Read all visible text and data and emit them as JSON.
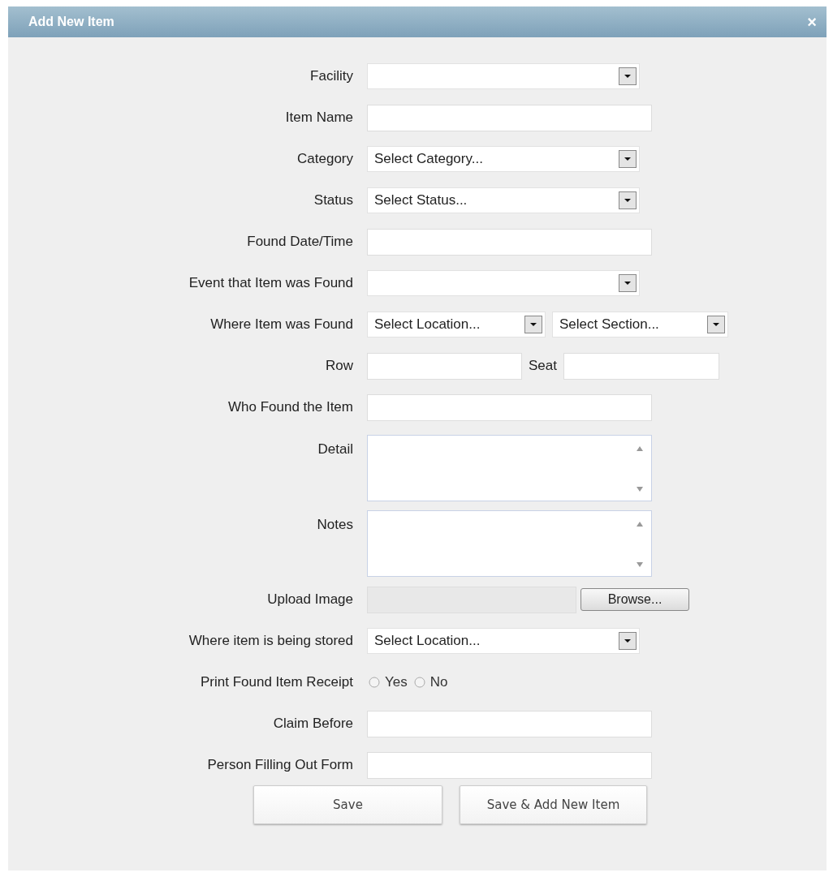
{
  "dialog": {
    "title": "Add New Item",
    "close": "×"
  },
  "fields": [
    {
      "kind": "select",
      "label": "Facility"
    },
    {
      "kind": "text",
      "label": "Item Name"
    },
    {
      "kind": "select",
      "label": "Category",
      "value": "Select Category..."
    },
    {
      "kind": "select",
      "label": "Status",
      "value": "Select Status..."
    },
    {
      "kind": "text",
      "label": "Found Date/Time"
    },
    {
      "kind": "select",
      "label": "Event that Item was Found"
    },
    {
      "kind": "select_pair",
      "label": "Where Item was Found",
      "values": [
        "Select Location...",
        "Select Section..."
      ]
    },
    {
      "kind": "row_seat",
      "label": "Row",
      "second_label": "Seat"
    },
    {
      "kind": "text",
      "label": "Who Found the Item"
    },
    {
      "kind": "textarea",
      "label": "Detail"
    },
    {
      "kind": "textarea",
      "label": "Notes"
    },
    {
      "kind": "file",
      "label": "Upload Image",
      "button": "Browse..."
    },
    {
      "kind": "select",
      "label": "Where item is being stored",
      "value": "Select Location..."
    },
    {
      "kind": "radio",
      "label": "Print Found Item Receipt",
      "options": [
        {
          "label": "Yes",
          "selected": false
        },
        {
          "label": "No",
          "selected": false
        }
      ]
    },
    {
      "kind": "text",
      "label": "Claim Before"
    },
    {
      "kind": "text",
      "label": "Person Filling Out Form"
    }
  ],
  "buttons": [
    "Save",
    "Save & Add New Item"
  ]
}
